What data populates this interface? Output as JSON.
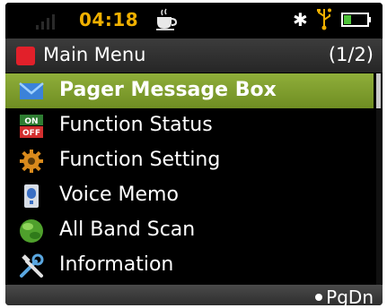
{
  "status_bar": {
    "time": "04:18",
    "icons": [
      "signal-icon",
      "coffee-cup-icon",
      "bluetooth-icon",
      "usb-icon",
      "battery-icon"
    ],
    "time_color": "#f0b000",
    "battery_fill_color": "#4fc23a"
  },
  "title_bar": {
    "title": "Main Menu",
    "page": "(1/2)",
    "icon_color": "#e2202a"
  },
  "menu": {
    "items": [
      {
        "label": "Pager Message Box",
        "icon": "envelope-icon",
        "selected": true
      },
      {
        "label": "Function Status",
        "icon": "on-off-icon",
        "selected": false
      },
      {
        "label": "Function Setting",
        "icon": "gear-icon",
        "selected": false
      },
      {
        "label": "Voice Memo",
        "icon": "voice-memo-icon",
        "selected": false
      },
      {
        "label": "All Band Scan",
        "icon": "globe-icon",
        "selected": false
      },
      {
        "label": "Information",
        "icon": "tools-icon",
        "selected": false
      }
    ],
    "selected_color": "#7f9e2e"
  },
  "footer": {
    "softkey": "PgDn"
  }
}
